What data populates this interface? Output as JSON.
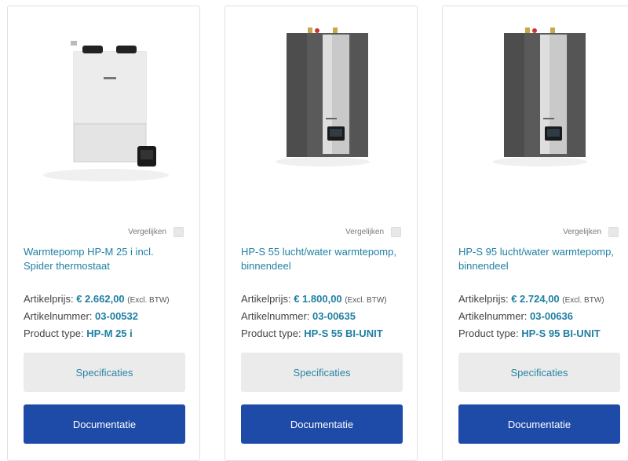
{
  "products": [
    {
      "compare_label": "Vergelijken",
      "title": "Warmtepomp HP-M 25 i incl. Spider thermostaat",
      "price_label": "Artikelprijs:",
      "price": "€ 2.662,00",
      "price_note": "(Excl. BTW)",
      "article_label": "Artikelnummer:",
      "article_number": "03-00532",
      "type_label": "Product type:",
      "type_value": "HP-M 25 i",
      "spec_button": "Specificaties",
      "doc_button": "Documentatie"
    },
    {
      "compare_label": "Vergelijken",
      "title": "HP-S 55 lucht/water warmtepomp, binnendeel",
      "price_label": "Artikelprijs:",
      "price": "€ 1.800,00",
      "price_note": "(Excl. BTW)",
      "article_label": "Artikelnummer:",
      "article_number": "03-00635",
      "type_label": "Product type:",
      "type_value": "HP-S 55 BI-UNIT",
      "spec_button": "Specificaties",
      "doc_button": "Documentatie"
    },
    {
      "compare_label": "Vergelijken",
      "title": "HP-S 95 lucht/water warmtepomp, binnendeel",
      "price_label": "Artikelprijs:",
      "price": "€ 2.724,00",
      "price_note": "(Excl. BTW)",
      "article_label": "Artikelnummer:",
      "article_number": "03-00636",
      "type_label": "Product type:",
      "type_value": "HP-S 95 BI-UNIT",
      "spec_button": "Specificaties",
      "doc_button": "Documentatie"
    }
  ],
  "colors": {
    "link": "#1f7fa2",
    "primary_button": "#1e4aa8",
    "secondary_button": "#ebebeb"
  }
}
